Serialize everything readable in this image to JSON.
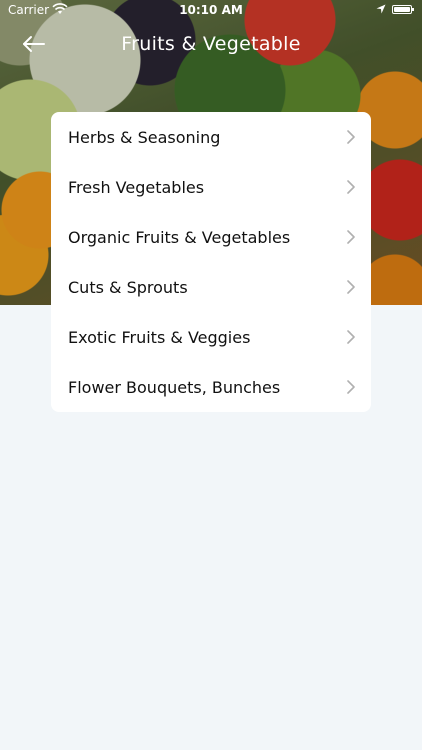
{
  "status_bar": {
    "carrier": "Carrier",
    "time": "10:10 AM"
  },
  "header": {
    "title": "Fruits & Vegetable",
    "back_icon": "arrow-left-icon"
  },
  "categories": [
    {
      "label": "Herbs & Seasoning"
    },
    {
      "label": "Fresh Vegetables"
    },
    {
      "label": "Organic Fruits & Vegetables"
    },
    {
      "label": "Cuts & Sprouts"
    },
    {
      "label": "Exotic Fruits & Veggies"
    },
    {
      "label": "Flower Bouquets, Bunches"
    }
  ],
  "colors": {
    "page_background": "#f2f6f9",
    "card_background": "#ffffff",
    "text": "#111111",
    "chevron": "#b0b0b0"
  }
}
